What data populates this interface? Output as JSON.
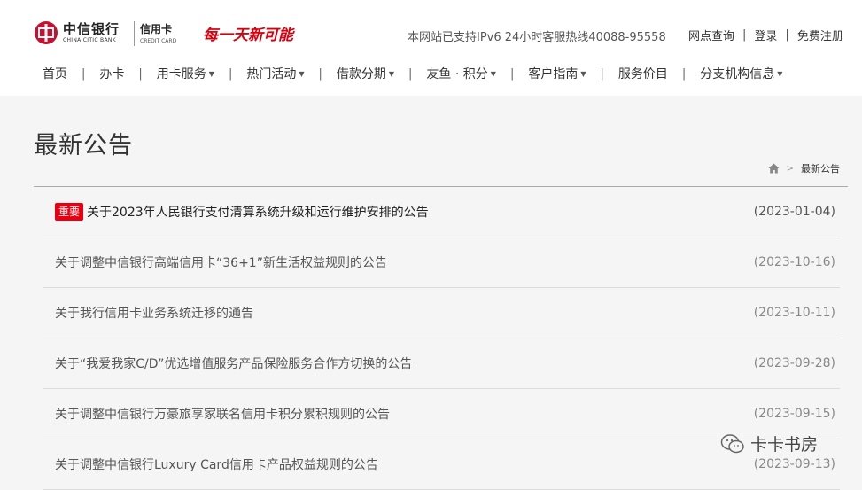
{
  "header": {
    "logo_cn": "中信银行",
    "logo_en": "CHINA CITIC BANK",
    "card_cn": "信用卡",
    "card_en": "CREDIT CARD",
    "slogan": "每一天新可能",
    "hotline": "本网站已支持IPv6 24小时客服热线40088-95558",
    "links": [
      "网点查询",
      "登录",
      "免费注册"
    ],
    "link_separator": "|",
    "brand_color": "#d7000f"
  },
  "nav": {
    "separator": "|",
    "items": [
      {
        "label": "首页",
        "dropdown": false
      },
      {
        "label": "办卡",
        "dropdown": false
      },
      {
        "label": "用卡服务",
        "dropdown": true
      },
      {
        "label": "热门活动",
        "dropdown": true
      },
      {
        "label": "借款分期",
        "dropdown": true
      },
      {
        "label": "友鱼 · 积分",
        "dropdown": true
      },
      {
        "label": "客户指南",
        "dropdown": true
      },
      {
        "label": "服务价目",
        "dropdown": false
      },
      {
        "label": "分支机构信息",
        "dropdown": true
      }
    ],
    "caret_icon": "caret-down-icon"
  },
  "page": {
    "title": "最新公告",
    "breadcrumb": {
      "home_icon": "home-icon",
      "arrow": ">",
      "current": "最新公告"
    }
  },
  "announcements": [
    {
      "badge": "重要",
      "title": "关于2023年人民银行支付清算系统升级和运行维护安排的公告",
      "date": "(2023-01-04)"
    },
    {
      "title": "关于调整中信银行高端信用卡“36+1”新生活权益规则的公告",
      "date": "(2023-10-16)"
    },
    {
      "title": "关于我行信用卡业务系统迁移的通告",
      "date": "(2023-10-11)"
    },
    {
      "title": "关于“我爱我家C/D”优选增值服务产品保险服务合作方切换的公告",
      "date": "(2023-09-28)"
    },
    {
      "title": "关于调整中信银行万豪旅享家联名信用卡积分累积规则的公告",
      "date": "(2023-09-15)"
    },
    {
      "title": "关于调整中信银行Luxury Card信用卡产品权益规则的公告",
      "date": "(2023-09-13)"
    }
  ],
  "watermark": {
    "icon": "wechat-icon",
    "text": "卡卡书房"
  }
}
